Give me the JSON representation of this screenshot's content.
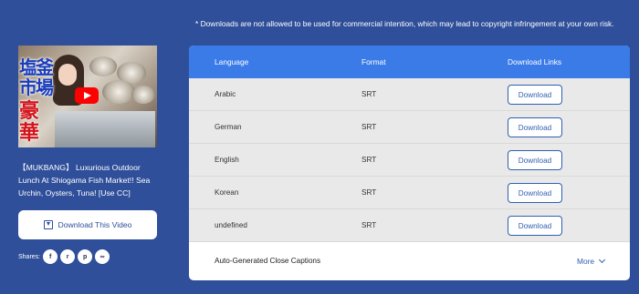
{
  "notice": "* Downloads are not allowed to be used for commercial intention, which may lead to copyright infringement at your own risk.",
  "video": {
    "thumbnail_text": {
      "left_blue": [
        "塩",
        "市"
      ],
      "left_blue2": [
        "釜",
        "場"
      ],
      "red": [
        "豪",
        "華"
      ]
    },
    "title": "【MUKBANG】 Luxurious Outdoor Lunch At Shiogama Fish Market!! Sea Urchin, Oysters, Tuna! [Use CC]",
    "download_label": "Download This Video",
    "shares_label": "Shares:",
    "share_icons": [
      "facebook-icon",
      "reddit-icon",
      "pocket-icon",
      "link-icon"
    ],
    "share_glyphs": [
      "f",
      "r",
      "p",
      "∞"
    ]
  },
  "table": {
    "headers": {
      "language": "Language",
      "format": "Format",
      "links": "Download Links"
    },
    "rows": [
      {
        "language": "Arabic",
        "format": "SRT",
        "button": "Download"
      },
      {
        "language": "German",
        "format": "SRT",
        "button": "Download"
      },
      {
        "language": "English",
        "format": "SRT",
        "button": "Download"
      },
      {
        "language": "Korean",
        "format": "SRT",
        "button": "Download"
      },
      {
        "language": "undefined",
        "format": "SRT",
        "button": "Download"
      }
    ],
    "auto_captions": "Auto-Generated Close Captions",
    "more": "More"
  },
  "colors": {
    "background": "#2f4f9a",
    "header": "#3a7be8",
    "accent": "#2f5fb0"
  }
}
